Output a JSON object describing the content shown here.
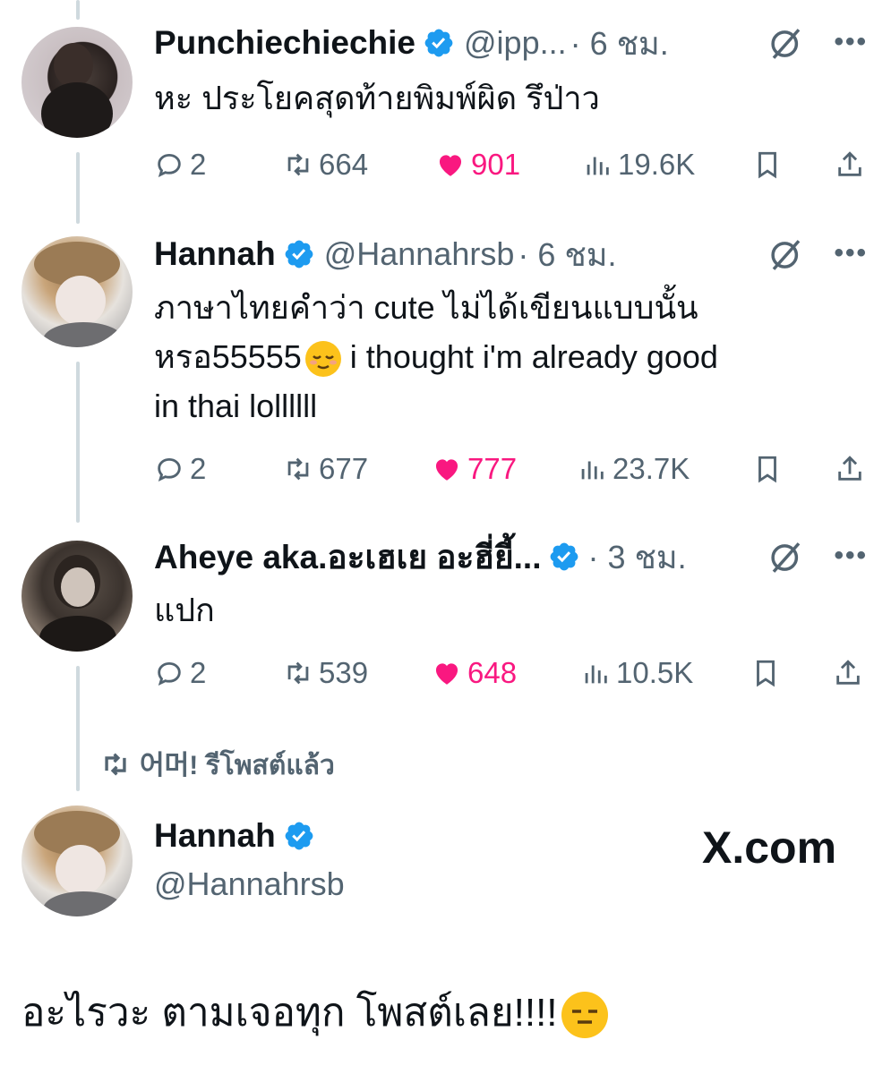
{
  "tweets": [
    {
      "name": "Punchiechiechie",
      "handle": "@ipp...",
      "time": "· 6 ชม.",
      "text": "หะ ประโยคสุดท้ายพิมพ์ผิด รึป่าว",
      "replies": "2",
      "reposts": "664",
      "likes": "901",
      "views": "19.6K"
    },
    {
      "name": "Hannah",
      "handle": "@Hannahrsb",
      "time": "· 6 ชม.",
      "text_line1": "ภาษาไทยคำว่า cute ไม่ได้เขียนแบบนั้น",
      "text_line2_a": "หรอ55555",
      "text_line2_b": " i thought i'm already good",
      "text_line3": "in thai lollllll",
      "replies": "2",
      "reposts": "677",
      "likes": "777",
      "views": "23.7K"
    },
    {
      "name": "Aheye aka.อะเฮเย อะฮี่ยี้...",
      "handle": "",
      "time": "· 3 ชม.",
      "text": "แปก",
      "replies": "2",
      "reposts": "539",
      "likes": "648",
      "views": "10.5K"
    }
  ],
  "repost_note": "어머! รีโพสต์แล้ว",
  "profile": {
    "name": "Hannah",
    "handle": "@Hannahrsb"
  },
  "watermark": "X.com",
  "caption": "อะไรวะ ตามเจอทุก โพสต์เลย!!!!",
  "colors": {
    "like": "#f91880",
    "verified": "#1d9bf0",
    "muted": "#536471"
  },
  "icons": [
    "reply-icon",
    "repost-icon",
    "heart-icon",
    "views-icon",
    "bookmark-icon",
    "share-icon",
    "grok-icon",
    "more-icon",
    "verified-icon",
    "relieved-face-emoji",
    "expressionless-face-emoji"
  ]
}
